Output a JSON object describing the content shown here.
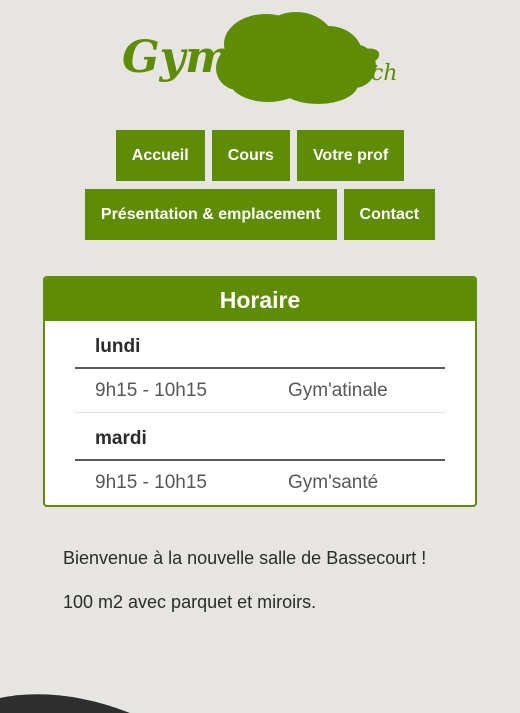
{
  "brand": {
    "logo_main": "Gym'agine",
    "logo_suffix": ".ch",
    "colors": {
      "primary": "#5e8c05",
      "background": "#e6e5e1",
      "text": "#2b2b2b"
    }
  },
  "nav": {
    "row1": [
      "Accueil",
      "Cours",
      "Votre prof"
    ],
    "row2": [
      "Présentation & emplacement",
      "Contact"
    ]
  },
  "schedule": {
    "title": "Horaire",
    "days": [
      {
        "day": "lundi",
        "slots": [
          {
            "time": "9h15 - 10h15",
            "class": "Gym'atinale"
          }
        ]
      },
      {
        "day": "mardi",
        "slots": [
          {
            "time": "9h15 - 10h15",
            "class": "Gym'santé"
          }
        ]
      }
    ]
  },
  "intro": {
    "line1": "Bienvenue à la nouvelle salle de Bassecourt !",
    "line2": "100 m2 avec parquet et miroirs."
  }
}
